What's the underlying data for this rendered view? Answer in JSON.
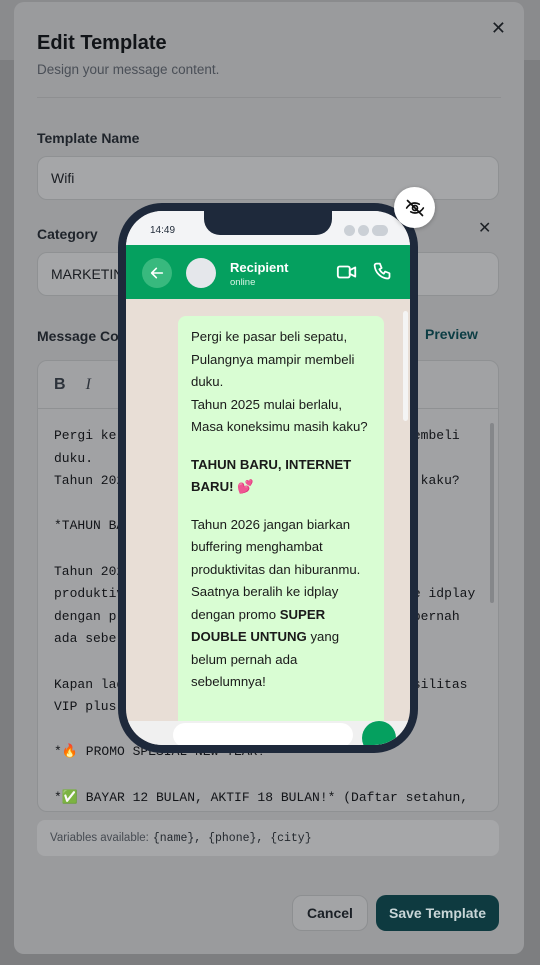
{
  "modal": {
    "title": "Edit Template",
    "subtitle": "Design your message content.",
    "close_icon": "close-icon"
  },
  "form": {
    "template_name_label": "Template Name",
    "template_name_value": "Wifi",
    "category_label": "Category",
    "category_value": "MARKETING",
    "message_label": "Message Content",
    "preview_label": "Preview"
  },
  "editor": {
    "bold": "B",
    "italic": "I",
    "lines": "Pergi ke pasar beli sepatu, Pulangnya mampir membeli\nduku.\nTahun 2025 mulai berlalu, Masa koneksimu masih kaku?\n\n*TAHUN BARU, INTERNET BARU!* 💕\n\nTahun 2026 jangan biarkan buffering menghambat\nproduktivitas dan hiburanmu. Saatnya beralih ke idplay\ndengan promo *SUPER DOUBLE UNTUNG* yang belum pernah\nada sebelumnya!\n\nKapan lagi bisa dapat internet cepat dengan fasilitas\nVIP plus bonus?\n\n*🔥 PROMO SPESIAL NEW YEAR!*\n\n*✅ BAYAR 12 BULAN, AKTIF 18 BULAN!* (Daftar setahun,"
  },
  "variables": {
    "label": "Variables available:",
    "codes": "{name}, {phone}, {city}"
  },
  "buttons": {
    "cancel": "Cancel",
    "save": "Save Template"
  },
  "phone": {
    "time": "14:49",
    "contact_name": "Recipient",
    "contact_status": "online",
    "accent": "#05a05f",
    "bubble_color": "#d9fdd3",
    "message": {
      "p1": "Pergi ke pasar beli sepatu, Pulangnya mampir membeli duku.",
      "p2": "Tahun 2025 mulai berlalu, Masa koneksimu masih kaku?",
      "p3": "TAHUN BARU, INTERNET BARU! 💕",
      "p4a": "Tahun 2026 jangan biarkan buffering menghambat produktivitas dan hiburanmu. Saatnya beralih ke idplay dengan promo",
      "p4b": "SUPER DOUBLE UNTUNG",
      "p4c": "yang belum pernah ada sebelumnya!"
    }
  }
}
